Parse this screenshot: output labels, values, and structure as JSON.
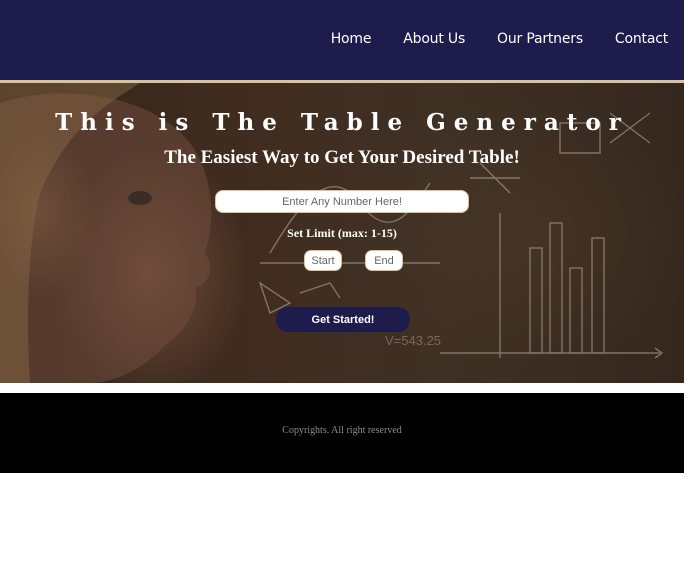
{
  "nav": {
    "links": [
      "Home",
      "About Us",
      "Our Partners",
      "Contact"
    ]
  },
  "hero": {
    "title": "This is The Table Generator",
    "subtitle": "The Easiest Way to Get Your Desired Table!",
    "number_placeholder": "Enter Any Number Here!",
    "limit_label": "Set Limit (max: 1-15)",
    "start_placeholder": "Start",
    "end_placeholder": "End",
    "cta_label": "Get Started!",
    "chalk_text": "V=543.25",
    "background_image": "girl-looking-at-chalkboard-with-math"
  },
  "footer": {
    "copyright": "Copyrights. All right reserved"
  },
  "colors": {
    "navbar_bg": "#1d1c4c",
    "accent_border": "#d8c39a",
    "footer_bg": "#000000",
    "button_bg": "#1d1c4c"
  }
}
